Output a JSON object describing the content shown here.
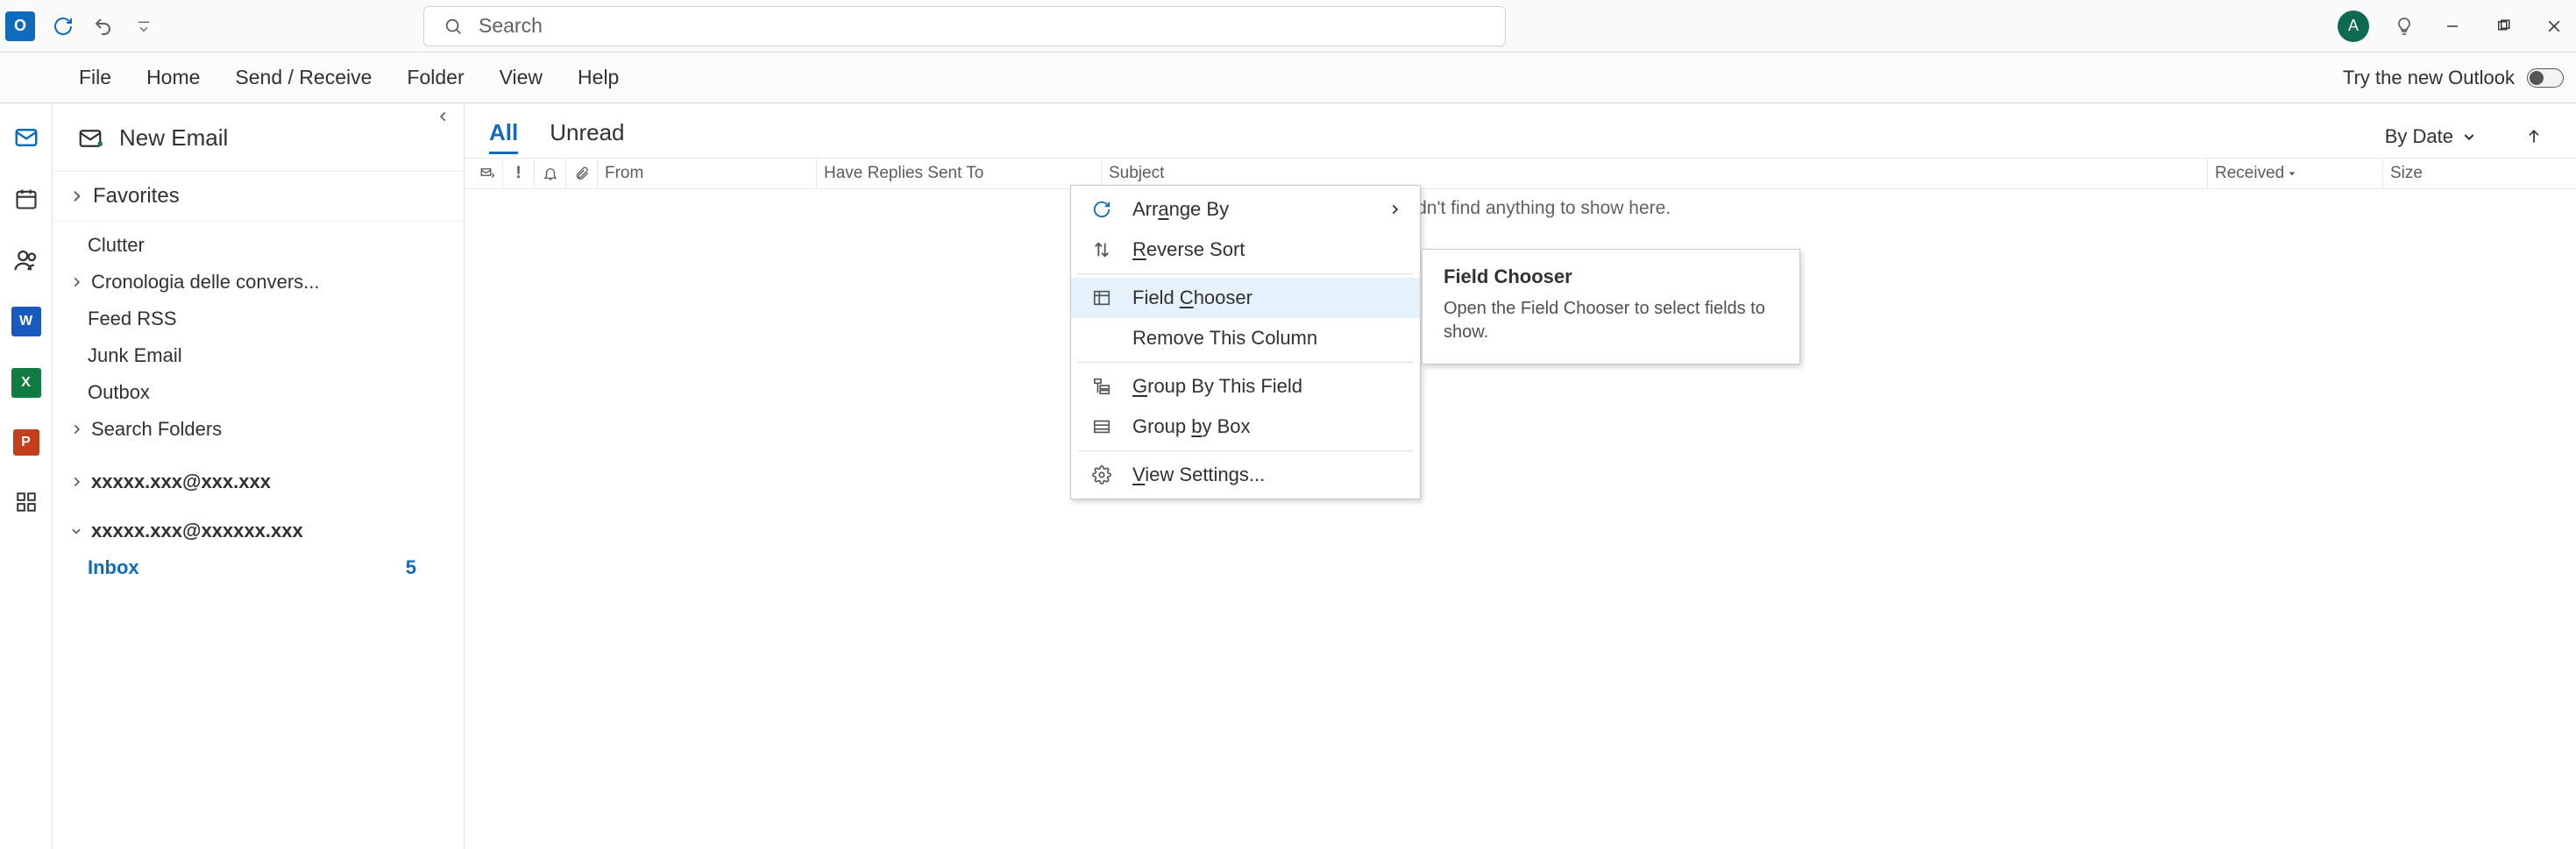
{
  "titlebar": {
    "app_letter": "O",
    "search_placeholder": "Search",
    "avatar_letter": "A"
  },
  "menu": {
    "file": "File",
    "home": "Home",
    "sendrecv": "Send / Receive",
    "folder": "Folder",
    "view": "View",
    "help": "Help",
    "try_new": "Try the new Outlook"
  },
  "folders": {
    "new_email": "New Email",
    "favorites": "Favorites",
    "clutter": "Clutter",
    "convo": "Cronologia delle convers...",
    "feed": "Feed RSS",
    "junk": "Junk Email",
    "outbox": "Outbox",
    "search": "Search Folders",
    "acct1": "xxxxx.xxx@xxx.xxx",
    "acct2": "xxxxx.xxx@xxxxxx.xxx",
    "inbox": "Inbox",
    "inbox_count": "5"
  },
  "msglist": {
    "tab_all": "All",
    "tab_unread": "Unread",
    "sort_label": "By Date",
    "col_from": "From",
    "col_replies": "Have Replies Sent To",
    "col_subject": "Subject",
    "col_received": "Received",
    "col_size": "Size",
    "empty": "We didn't find anything to show here."
  },
  "ctx": {
    "arrange_pre": "Arr",
    "arrange_mn": "a",
    "arrange_post": "nge By",
    "reverse_mn": "R",
    "reverse_post": "everse Sort",
    "field_pre": "Field ",
    "field_mn": "C",
    "field_post": "hooser",
    "remove": "Remove This Column",
    "group_field_mn": "G",
    "group_field_post": "roup By This Field",
    "group_box_pre": "Group ",
    "group_box_mn": "b",
    "group_box_post": "y Box",
    "view_mn": "V",
    "view_post": "iew Settings..."
  },
  "tooltip": {
    "title": "Field Chooser",
    "body": "Open the Field Chooser to select fields to show."
  }
}
